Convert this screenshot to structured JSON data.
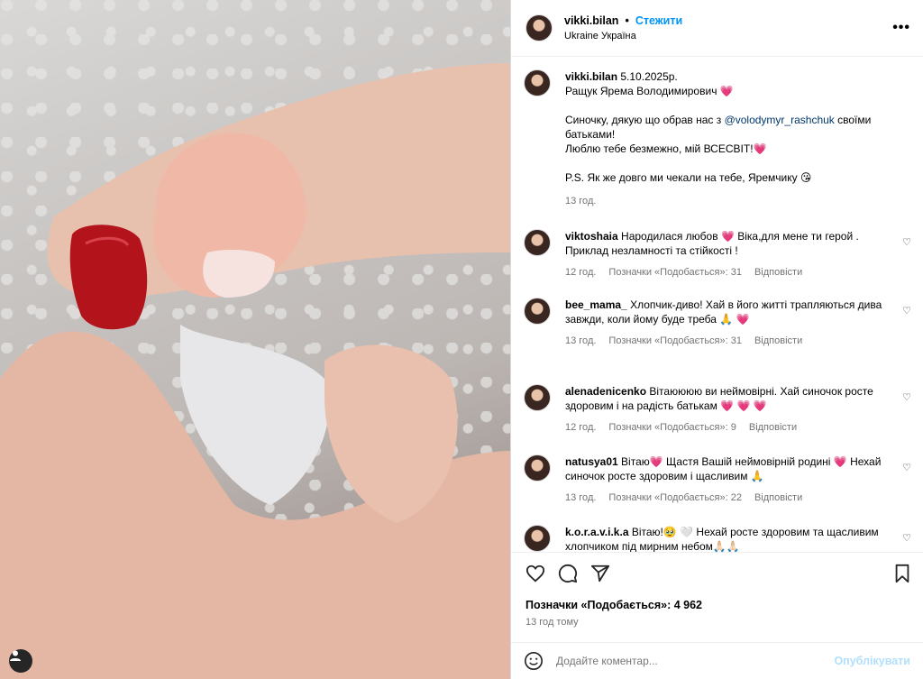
{
  "post": {
    "username": "vikki.bilan",
    "follow_label": "Стежити",
    "location": "Ukraine Україна",
    "more_label": "•••"
  },
  "caption": {
    "username": "vikki.bilan",
    "line1": "5.10.2025р.",
    "line2": "Ращук Ярема Володимирович 💗",
    "line3a": "Синочку, дякую що обрав нас з ",
    "mention": "@volodymyr_rashchuk",
    "line3b": " своїми батьками!",
    "line4": "Люблю тебе безмежно, мій ВСЕСВІТ!💗",
    "line5": "P.S. Як же довго ми чекали на тебе, Яремчику 😘",
    "time": "13 год."
  },
  "comments": [
    {
      "username": "viktoshaia",
      "text": "Народилася любов 💗 Віка,для мене ти герой . Приклад незламності та стійкості !",
      "time": "12 год.",
      "likes": "Позначки «Подобається»: 31",
      "reply": "Відповісти"
    },
    {
      "username": "bee_mama_",
      "text": "Хлопчик-диво! Хай в його житті трапляються дива завжди, коли йому буде треба 🙏 💗",
      "time": "13 год.",
      "likes": "Позначки «Подобається»: 31",
      "reply": "Відповісти"
    },
    {
      "username": "alenadenicenko",
      "text": "Вітаюююю ви неймовірні. Хай синочок росте здоровим і на радість батькам 💗 💗 💗",
      "time": "12 год.",
      "likes": "Позначки «Подобається»: 9",
      "reply": "Відповісти"
    },
    {
      "username": "natusya01",
      "text": "Вітаю💗 Щастя Вашій неймовірній родині 💗 Нехай синочок росте здоровим і щасливим 🙏",
      "time": "13 год.",
      "likes": "Позначки «Подобається»: 22",
      "reply": "Відповісти"
    },
    {
      "username": "k.o.r.a.v.i.k.a",
      "text": "Вітаю!🥹 🤍 Нехай росте здоровим та щасливим хлопчиком під мирним небом🙏🏻🙏🏻",
      "time": "",
      "likes": "",
      "reply": ""
    }
  ],
  "footer": {
    "likes": "Позначки «Подобається»: 4 962",
    "time_ago": "13 год тому",
    "comment_placeholder": "Додайте коментар...",
    "publish_label": "Опублікувати"
  },
  "colors": {
    "accent": "#0095f6",
    "publish_disabled": "#b2dffc",
    "heart": "#e8336c",
    "nail": "#b3141c"
  }
}
